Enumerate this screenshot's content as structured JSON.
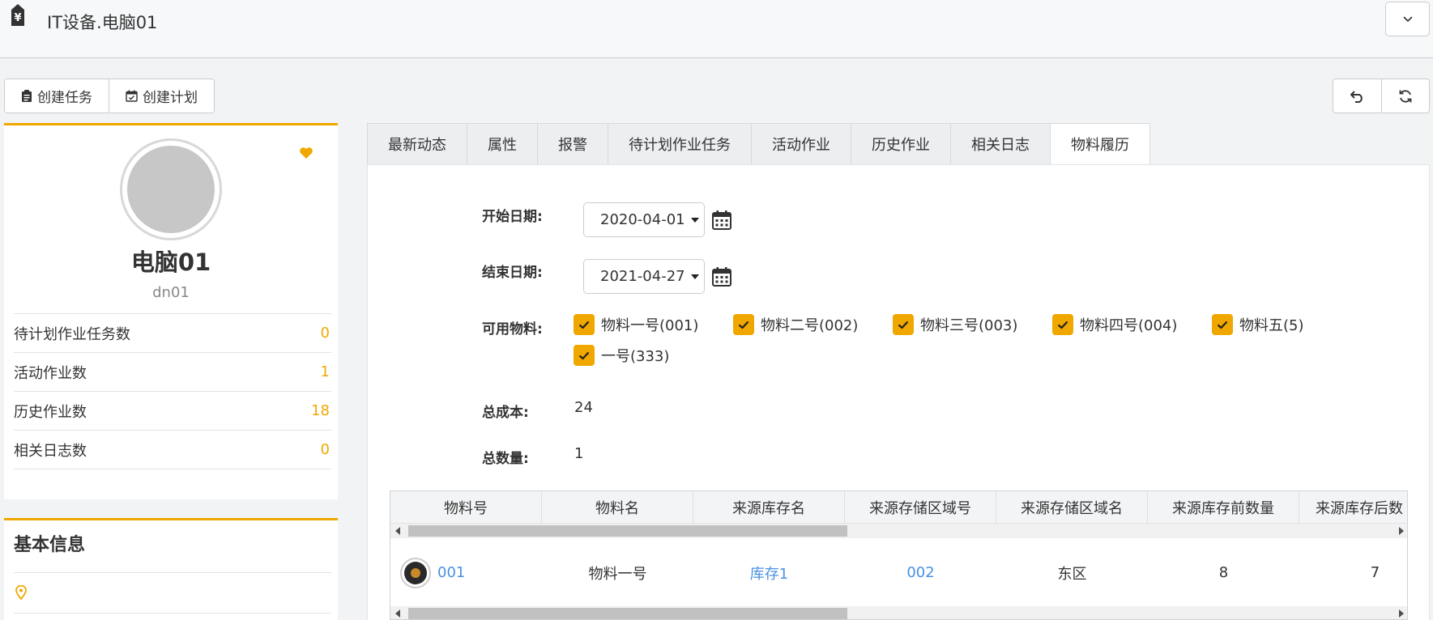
{
  "header": {
    "title": "IT设备.电脑01",
    "app_icon": "price-tag-yen-icon"
  },
  "toolbar": {
    "create_task": "创建任务",
    "create_plan": "创建计划"
  },
  "profile": {
    "name": "电脑01",
    "code": "dn01",
    "stats": [
      {
        "label": "待计划作业任务数",
        "value": "0"
      },
      {
        "label": "活动作业数",
        "value": "1"
      },
      {
        "label": "历史作业数",
        "value": "18"
      },
      {
        "label": "相关日志数",
        "value": "0"
      }
    ]
  },
  "basic_info": {
    "title": "基本信息"
  },
  "tabs": [
    "最新动态",
    "属性",
    "报警",
    "待计划作业任务",
    "活动作业",
    "历史作业",
    "相关日志",
    "物料履历"
  ],
  "active_tab": "物料履历",
  "form": {
    "start_label": "开始日期:",
    "start_value": "2020-04-01",
    "end_label": "结束日期:",
    "end_value": "2021-04-27",
    "materials_label": "可用物料:",
    "materials": [
      "物料一号(001)",
      "物料二号(002)",
      "物料三号(003)",
      "物料四号(004)",
      "物料五(5)",
      "一号(333)"
    ],
    "total_cost_label": "总成本:",
    "total_cost": "24",
    "total_qty_label": "总数量:",
    "total_qty": "1"
  },
  "table": {
    "columns": [
      "物料号",
      "物料名",
      "来源库存名",
      "来源存储区域号",
      "来源存储区域名",
      "来源库存前数量",
      "来源库存后数"
    ],
    "rows": [
      [
        "001",
        "物料一号",
        "库存1",
        "002",
        "东区",
        "8",
        "7"
      ]
    ]
  },
  "colors": {
    "accent": "#f0a800",
    "link": "#4a90e2"
  }
}
